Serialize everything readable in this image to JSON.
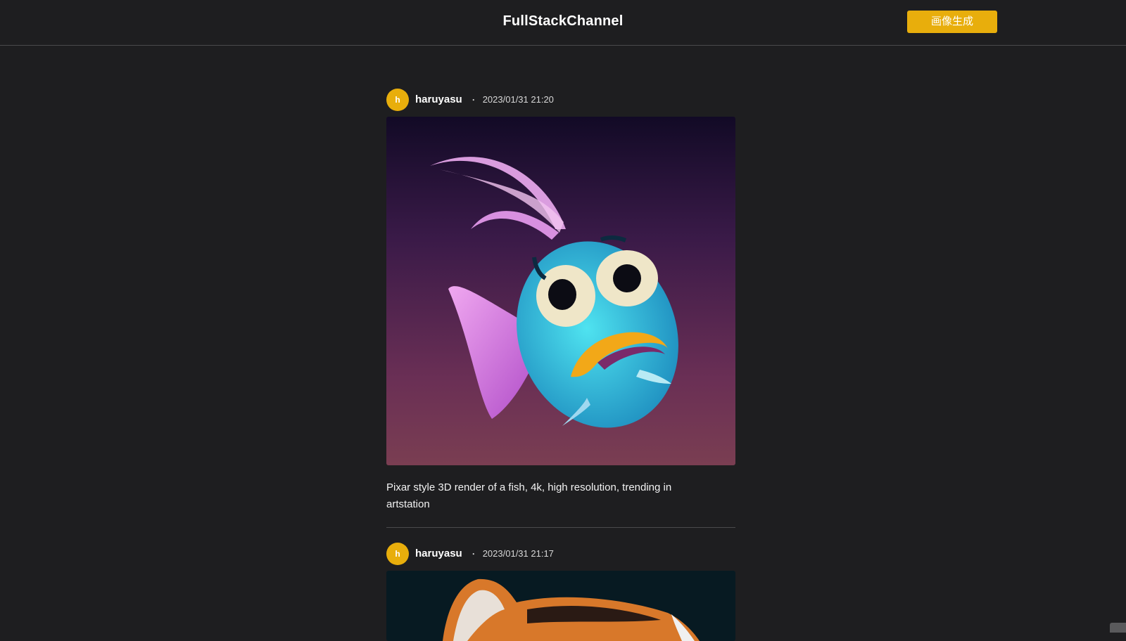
{
  "header": {
    "title": "FullStackChannel",
    "generate_button_label": "画像生成"
  },
  "posts": [
    {
      "avatar_initial": "h",
      "username": "haruyasu",
      "separator": "・",
      "timestamp": "2023/01/31 21:20",
      "image_subject": "cartoon blue fish with pink fins on purple gradient background",
      "caption": "Pixar style 3D render of a fish, 4k, high resolution, trending in artstation"
    },
    {
      "avatar_initial": "h",
      "username": "haruyasu",
      "separator": "・",
      "timestamp": "2023/01/31 21:17",
      "image_subject": "cartoon orange animal on dark teal background (partially visible)"
    }
  ],
  "colors": {
    "background": "#1e1e20",
    "accent": "#e8ae0c",
    "divider": "#4a4a4c"
  }
}
